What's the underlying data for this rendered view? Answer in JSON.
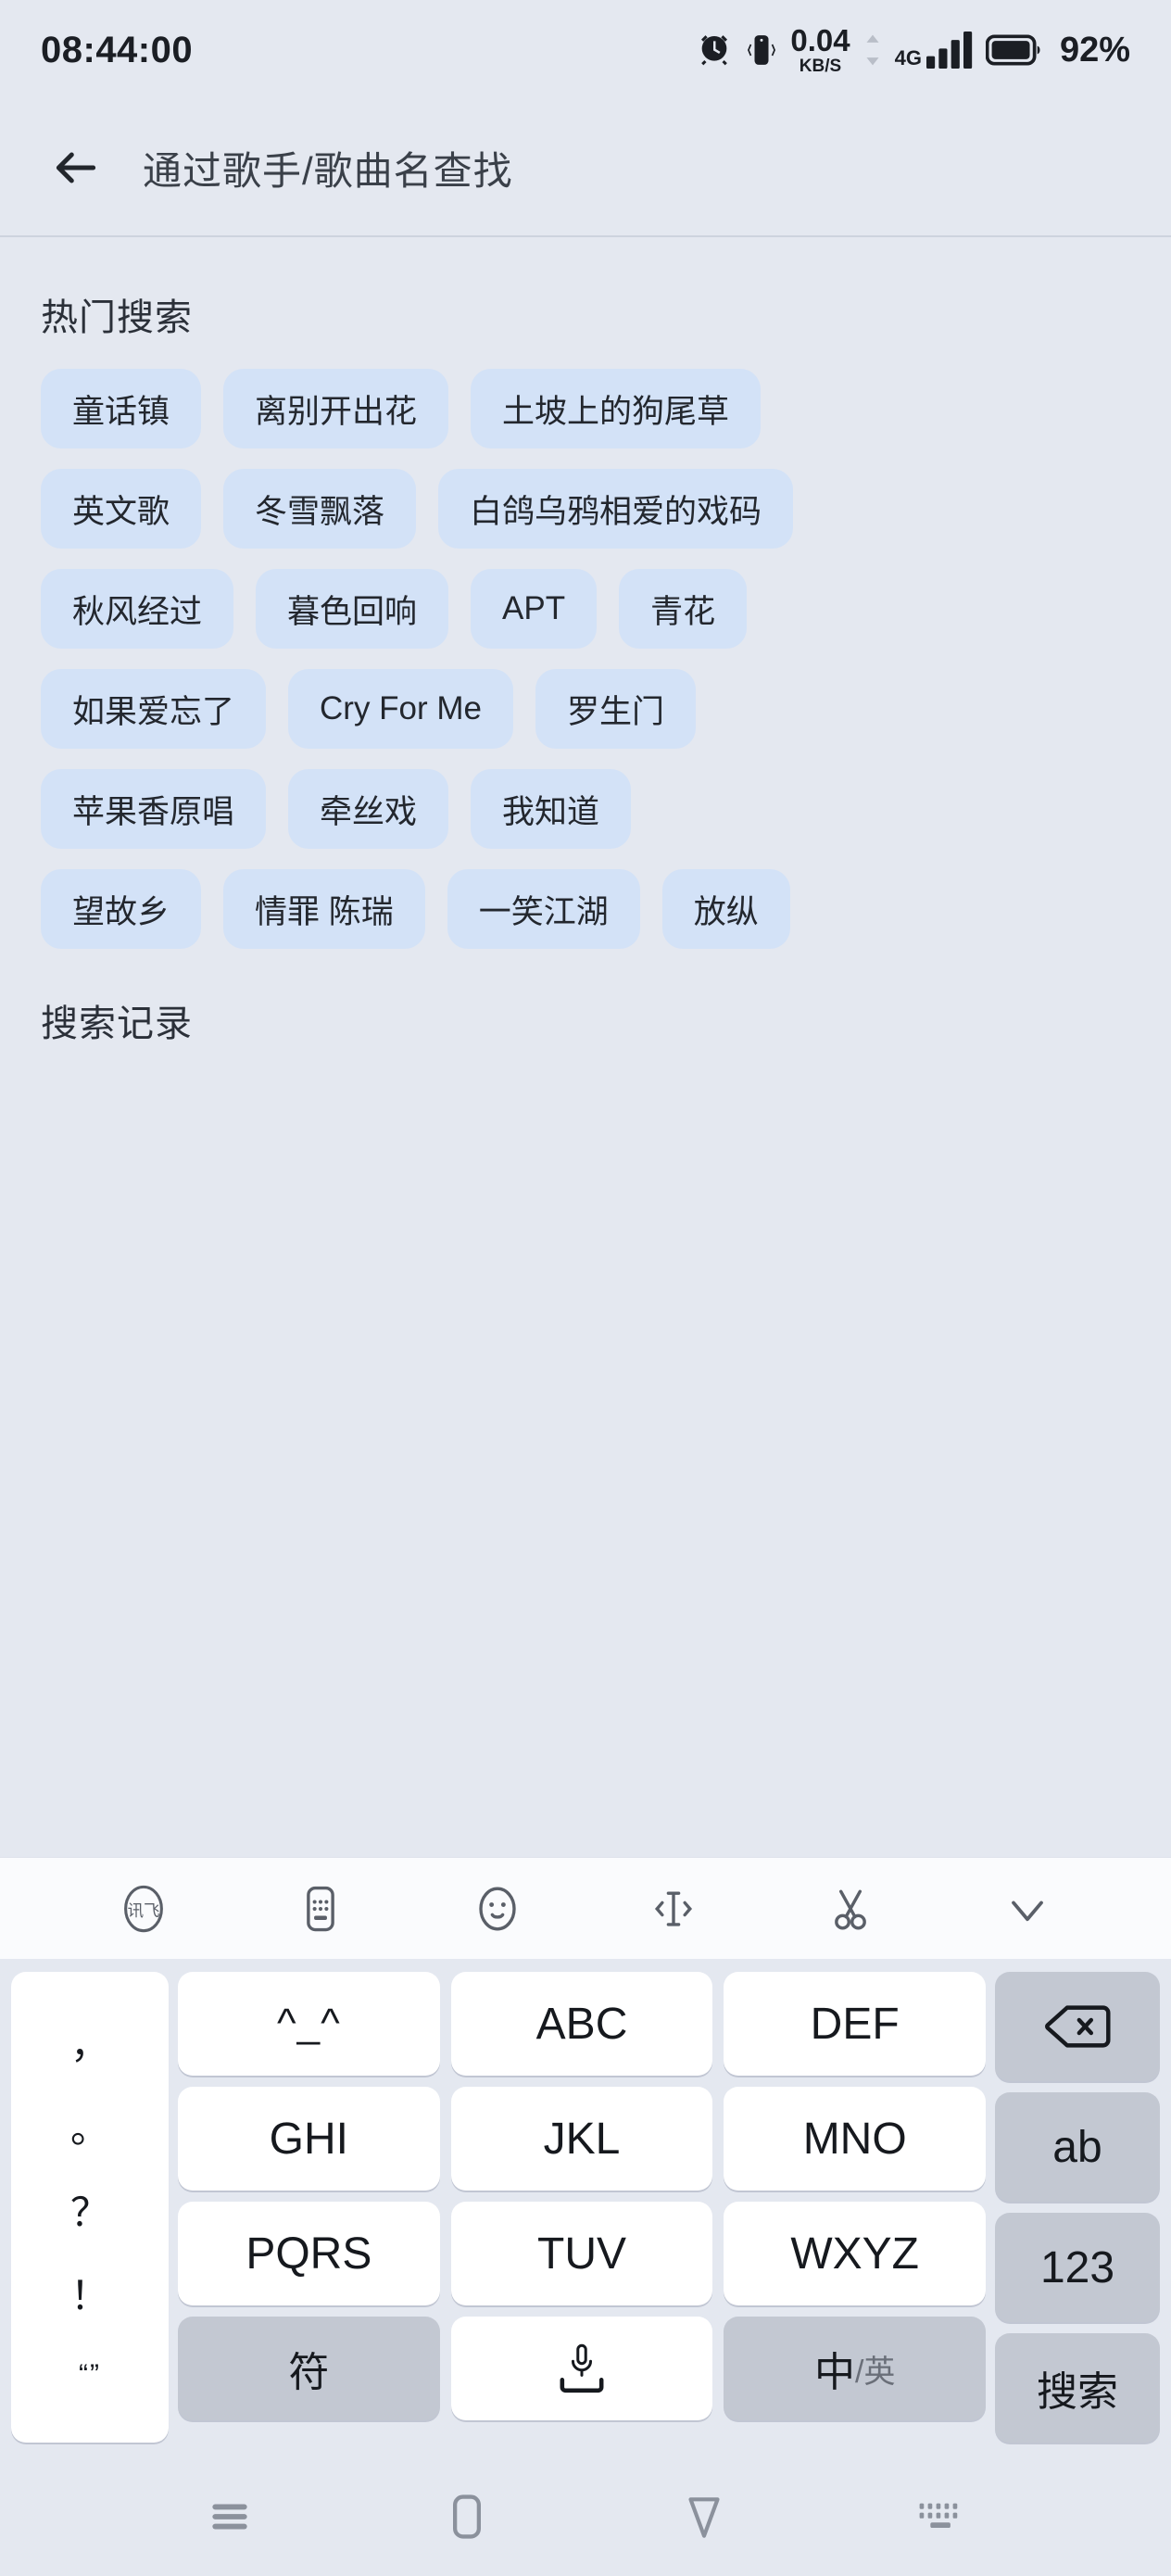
{
  "statusbar": {
    "clock": "08:44:00",
    "netspeed_value": "0.04",
    "netspeed_unit": "KB/S",
    "network_type": "4G",
    "battery_percent": "92%",
    "icons": [
      "alarm-icon",
      "vibrate-icon",
      "data-arrows-icon",
      "signal-bars-icon",
      "battery-icon"
    ]
  },
  "appbar": {
    "back_label": "back-arrow",
    "title": "通过歌手/歌曲名查找"
  },
  "hot_search": {
    "title": "热门搜索",
    "rows": [
      [
        "童话镇",
        "离别开出花",
        "土坡上的狗尾草"
      ],
      [
        "英文歌",
        "冬雪飘落",
        "白鸽乌鸦相爱的戏码"
      ],
      [
        "秋风经过",
        "暮色回响",
        "APT",
        "青花"
      ],
      [
        "如果爱忘了",
        "Cry For Me",
        "罗生门"
      ],
      [
        "苹果香原唱",
        "牵丝戏",
        "我知道"
      ],
      [
        "望故乡",
        "情罪 陈瑞",
        "一笑江湖",
        "放纵"
      ]
    ]
  },
  "history": {
    "title": "搜索记录"
  },
  "keyboard": {
    "toolbar": [
      {
        "name": "ime-logo-icon",
        "label": "讯飞"
      },
      {
        "name": "keyboard-layout-icon",
        "label": "键盘"
      },
      {
        "name": "emoji-icon",
        "label": "表情"
      },
      {
        "name": "text-cursor-icon",
        "label": "编辑"
      },
      {
        "name": "scissors-icon",
        "label": "剪切"
      },
      {
        "name": "collapse-keyboard-icon",
        "label": "收起"
      }
    ],
    "punct_key": {
      "name": "punctuation-key",
      "marks": [
        "，",
        "。",
        "？",
        "！",
        "“”"
      ]
    },
    "rows": [
      [
        {
          "label": "^_^",
          "name": "kaomoji-key",
          "style": "emoji"
        },
        {
          "label": "ABC",
          "name": "key-abc",
          "style": "normal"
        },
        {
          "label": "DEF",
          "name": "key-def",
          "style": "normal"
        }
      ],
      [
        {
          "label": "GHI",
          "name": "key-ghi",
          "style": "normal"
        },
        {
          "label": "JKL",
          "name": "key-jkl",
          "style": "normal"
        },
        {
          "label": "MNO",
          "name": "key-mno",
          "style": "normal"
        }
      ],
      [
        {
          "label": "PQRS",
          "name": "key-pqrs",
          "style": "normal"
        },
        {
          "label": "TUV",
          "name": "key-tuv",
          "style": "normal"
        },
        {
          "label": "WXYZ",
          "name": "key-wxyz",
          "style": "normal"
        }
      ]
    ],
    "right_keys": [
      {
        "label": "",
        "name": "backspace-key",
        "style": "fn",
        "icon": "backspace-icon"
      },
      {
        "label": "ab",
        "name": "key-ab",
        "style": "fn"
      },
      {
        "label": "123",
        "name": "key-123",
        "style": "fn"
      },
      {
        "label": "搜索",
        "name": "search-key",
        "style": "fn"
      }
    ],
    "bottom_row": [
      {
        "label": "符",
        "name": "symbol-key",
        "style": "fn"
      },
      {
        "label": "",
        "name": "space-key",
        "style": "space",
        "icon": "microphone-icon"
      },
      {
        "label": "中",
        "sub": "/英",
        "name": "language-toggle-key",
        "style": "fn"
      }
    ]
  },
  "navbar": [
    {
      "name": "recents-menu-icon",
      "label": "菜单"
    },
    {
      "name": "home-icon",
      "label": "主页"
    },
    {
      "name": "back-nav-icon",
      "label": "返回"
    },
    {
      "name": "keyboard-indicator-icon",
      "label": "键盘"
    }
  ]
}
